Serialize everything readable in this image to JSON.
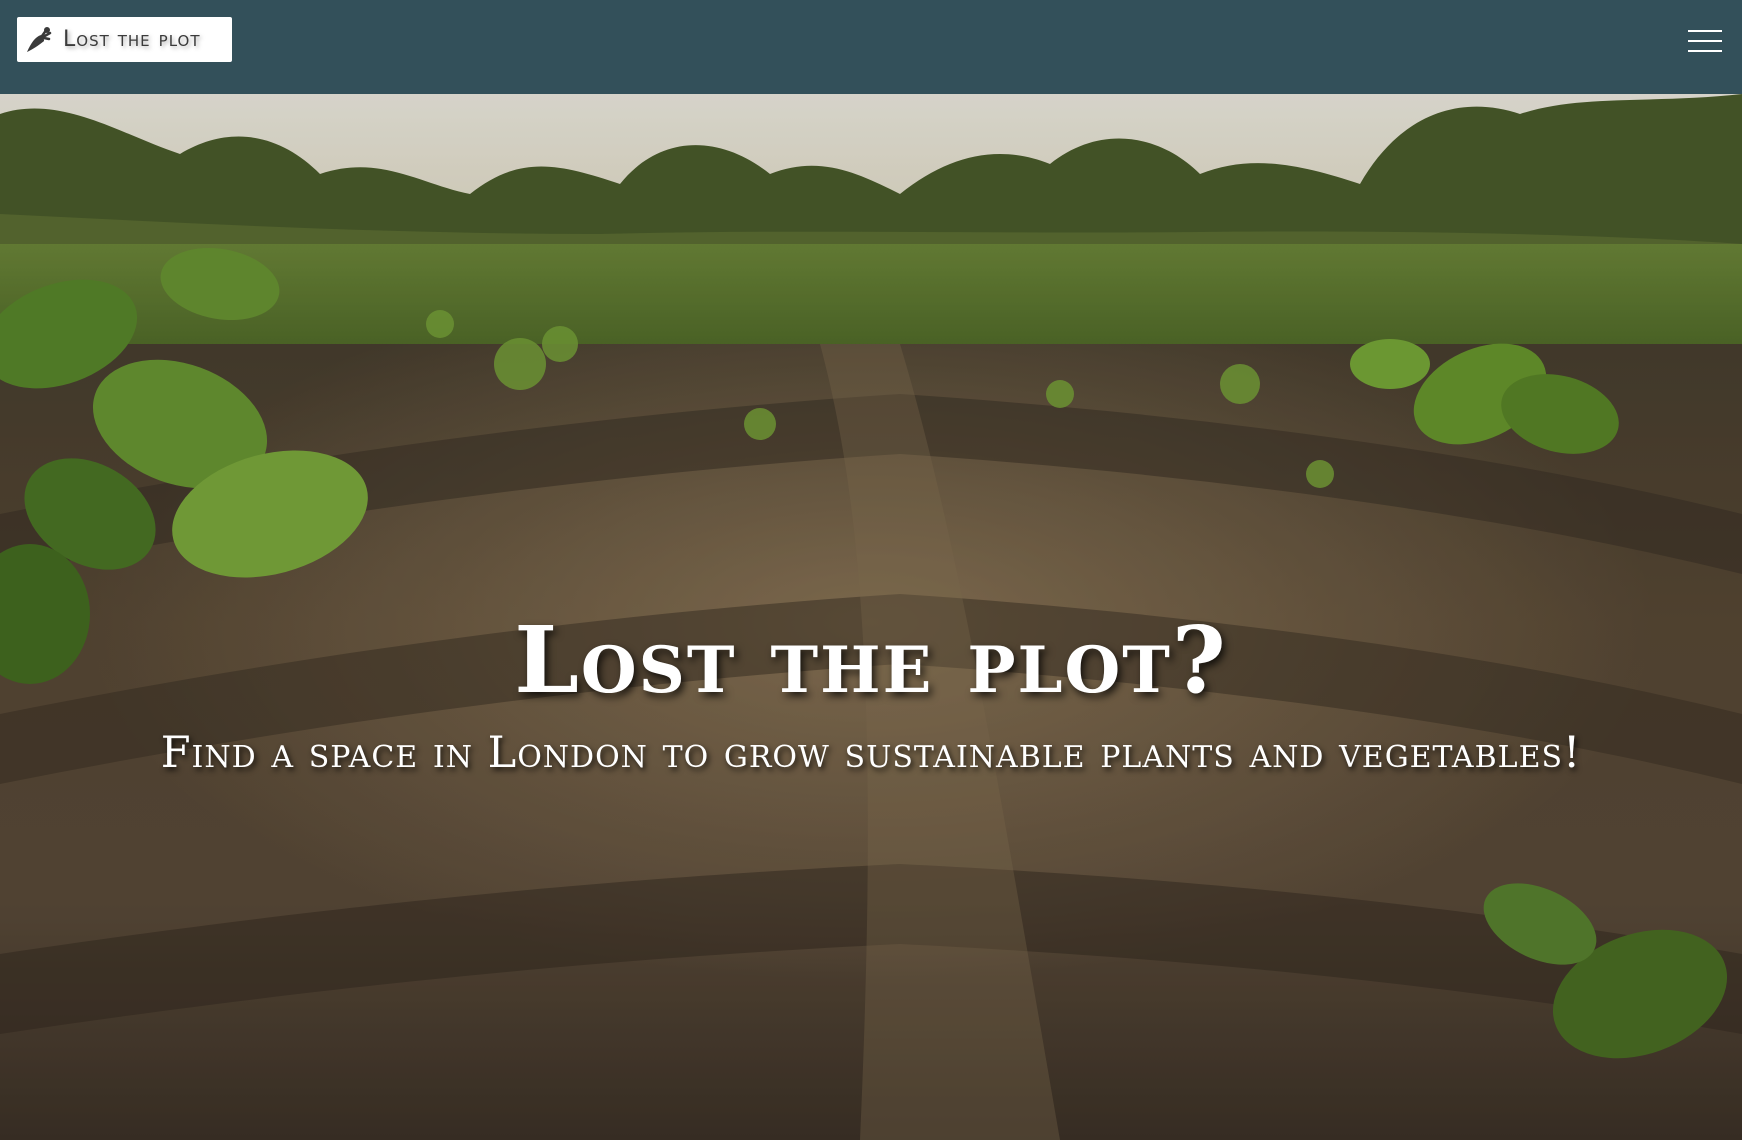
{
  "navbar": {
    "brand_label": "Lost the plot",
    "brand_icon": "carrot-icon",
    "menu_icon": "hamburger-menu-icon"
  },
  "hero": {
    "title": "Lost the plot?",
    "subtitle": "Find a space in London to grow sustainable plants and vegetables!",
    "background_image": "field-of-crops-photo"
  },
  "colors": {
    "navbar_bg": "#33505a",
    "brand_bg": "#ffffff",
    "brand_text": "#3b3b3b",
    "hero_text": "#ffffff"
  }
}
